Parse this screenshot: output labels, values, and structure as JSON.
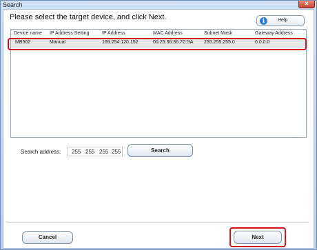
{
  "window": {
    "title": "Search",
    "close_glyph": "×"
  },
  "instruction": "Please select the target device, and click Next.",
  "help": {
    "label": "Help",
    "icon": "info-icon",
    "glyph": "i"
  },
  "table": {
    "columns": [
      "Device name",
      "IP Address Setting",
      "IP Address",
      "MAC Address",
      "Subnet Mask",
      "Gateway Address"
    ],
    "rows": [
      [
        "MB562",
        "Manual",
        "169.254.120.152",
        "00:25:36:36:7C:5A",
        "255.255.255.0",
        "0.0.0.0"
      ]
    ]
  },
  "search": {
    "label": "Search address:",
    "octets": [
      "255",
      "255",
      "255",
      "255"
    ],
    "dot": ".",
    "button_label": "Search"
  },
  "footer": {
    "cancel_label": "Cancel",
    "next_label": "Next"
  },
  "colors": {
    "highlight": "#d0101c",
    "help_icon": "#2f7cd6",
    "row_selected": "#e7e7e7"
  }
}
